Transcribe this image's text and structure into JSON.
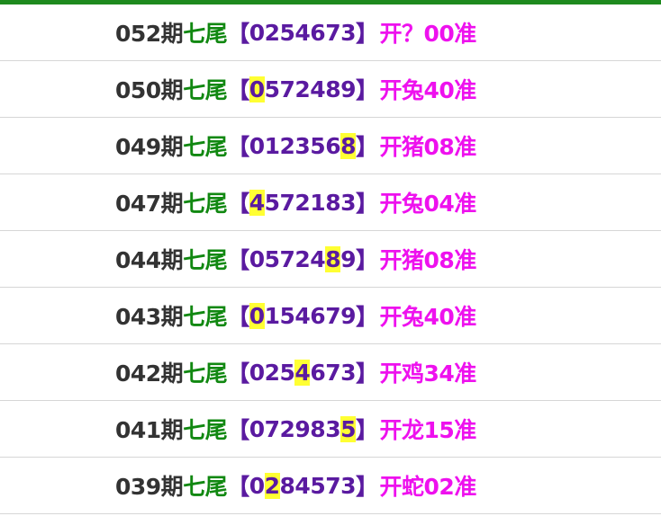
{
  "colors": {
    "top_bar": "#1e8a1e",
    "issue": "#333333",
    "label": "#118811",
    "digits": "#5a1aa0",
    "result": "#ee11ee",
    "highlight": "#ffff33"
  },
  "rows": [
    {
      "issue": "052期",
      "label": "七尾",
      "open": "【",
      "pre": "0254673",
      "hit": "",
      "post": "",
      "close": "】",
      "result": "开？00准"
    },
    {
      "issue": "050期",
      "label": "七尾",
      "open": "【",
      "pre": "",
      "hit": "0",
      "post": "572489",
      "close": "】",
      "result": "开兔40准"
    },
    {
      "issue": "049期",
      "label": "七尾",
      "open": "【",
      "pre": "012356",
      "hit": "8",
      "post": "",
      "close": "】",
      "result": "开猪08准"
    },
    {
      "issue": "047期",
      "label": "七尾",
      "open": "【",
      "pre": "",
      "hit": "4",
      "post": "572183",
      "close": "】",
      "result": "开兔04准"
    },
    {
      "issue": "044期",
      "label": "七尾",
      "open": "【",
      "pre": "05724",
      "hit": "8",
      "post": "9",
      "close": "】",
      "result": "开猪08准"
    },
    {
      "issue": "043期",
      "label": "七尾",
      "open": "【",
      "pre": "",
      "hit": "0",
      "post": "154679",
      "close": "】",
      "result": "开兔40准"
    },
    {
      "issue": "042期",
      "label": "七尾",
      "open": "【",
      "pre": "025",
      "hit": "4",
      "post": "673",
      "close": "】",
      "result": "开鸡34准"
    },
    {
      "issue": "041期",
      "label": "七尾",
      "open": "【",
      "pre": "072983",
      "hit": "5",
      "post": "",
      "close": "】",
      "result": "开龙15准"
    },
    {
      "issue": "039期",
      "label": "七尾",
      "open": "【",
      "pre": "0",
      "hit": "2",
      "post": "84573",
      "close": "】",
      "result": "开蛇02准"
    }
  ]
}
